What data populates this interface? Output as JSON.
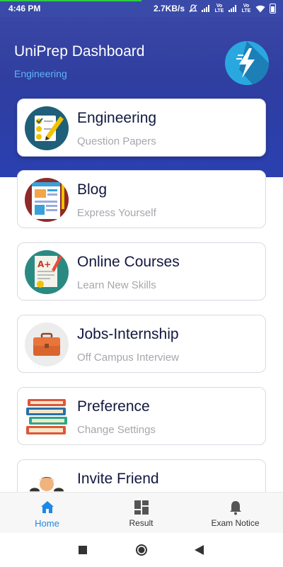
{
  "status_bar": {
    "time": "4:46 PM",
    "speed": "2.7KB/s",
    "lte_label_1": "Vo LTE",
    "lte_label_2": "Vo LTE"
  },
  "header": {
    "title": "UniPrep Dashboard",
    "subtitle": "Engineering",
    "logo_icon": "lightning-bolt-icon"
  },
  "cards": [
    {
      "title": "Engineering",
      "subtitle": "Question Papers",
      "icon": "exam-paper-checklist-icon"
    },
    {
      "title": "Blog",
      "subtitle": "Express Yourself",
      "icon": "blog-article-icon"
    },
    {
      "title": "Online Courses",
      "subtitle": "Learn New Skills",
      "icon": "graded-paper-icon"
    },
    {
      "title": "Jobs-Internship",
      "subtitle": "Off Campus Interview",
      "icon": "briefcase-icon"
    },
    {
      "title": "Preference",
      "subtitle": "Change Settings",
      "icon": "book-stack-icon"
    },
    {
      "title": "Invite Friend",
      "subtitle": "",
      "icon": "people-group-icon"
    }
  ],
  "bottom_nav": [
    {
      "label": "Home",
      "icon": "home-icon",
      "active": true
    },
    {
      "label": "Result",
      "icon": "dashboard-grid-icon",
      "active": false
    },
    {
      "label": "Exam Notice",
      "icon": "bell-icon",
      "active": false
    }
  ],
  "colors": {
    "header_bg": "#3a46a5",
    "accent": "#1e88e5",
    "subtitle": "#5fb4f6",
    "card_title": "#12183f",
    "card_subtitle": "#a5a7ad"
  }
}
